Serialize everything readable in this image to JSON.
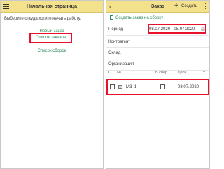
{
  "left": {
    "title": "Начальная страница",
    "prompt": "Выберите откуда хотите начать работу:",
    "links": {
      "new_order": "Новый заказ",
      "order_list": "Список заказов",
      "report_list": "Список сборок"
    }
  },
  "right": {
    "title": "Заказ",
    "create_label": "Создать",
    "create_order_link": "Создать заказ на сборку",
    "fields": {
      "period_label": "Период",
      "period_value": "08.07.2020 - 08.07.2020",
      "contractor_label": "Контрагент",
      "warehouse_label": "Склад",
      "organization_label": "Организация"
    },
    "table": {
      "headers": [
        "С",
        "№",
        "В сбор...",
        "Дата"
      ],
      "rows": [
        {
          "number": "МЗ_1",
          "date": "08.07.2020"
        }
      ]
    }
  },
  "colors": {
    "header_bg": "#f4e18c",
    "link_green": "#2e8b57",
    "highlight_red": "#e8102a"
  },
  "icons": [
    "hamburger-icon",
    "back-icon",
    "plus-icon",
    "more-vertical-icon",
    "clear-icon",
    "sort-icon",
    "status-icon"
  ]
}
